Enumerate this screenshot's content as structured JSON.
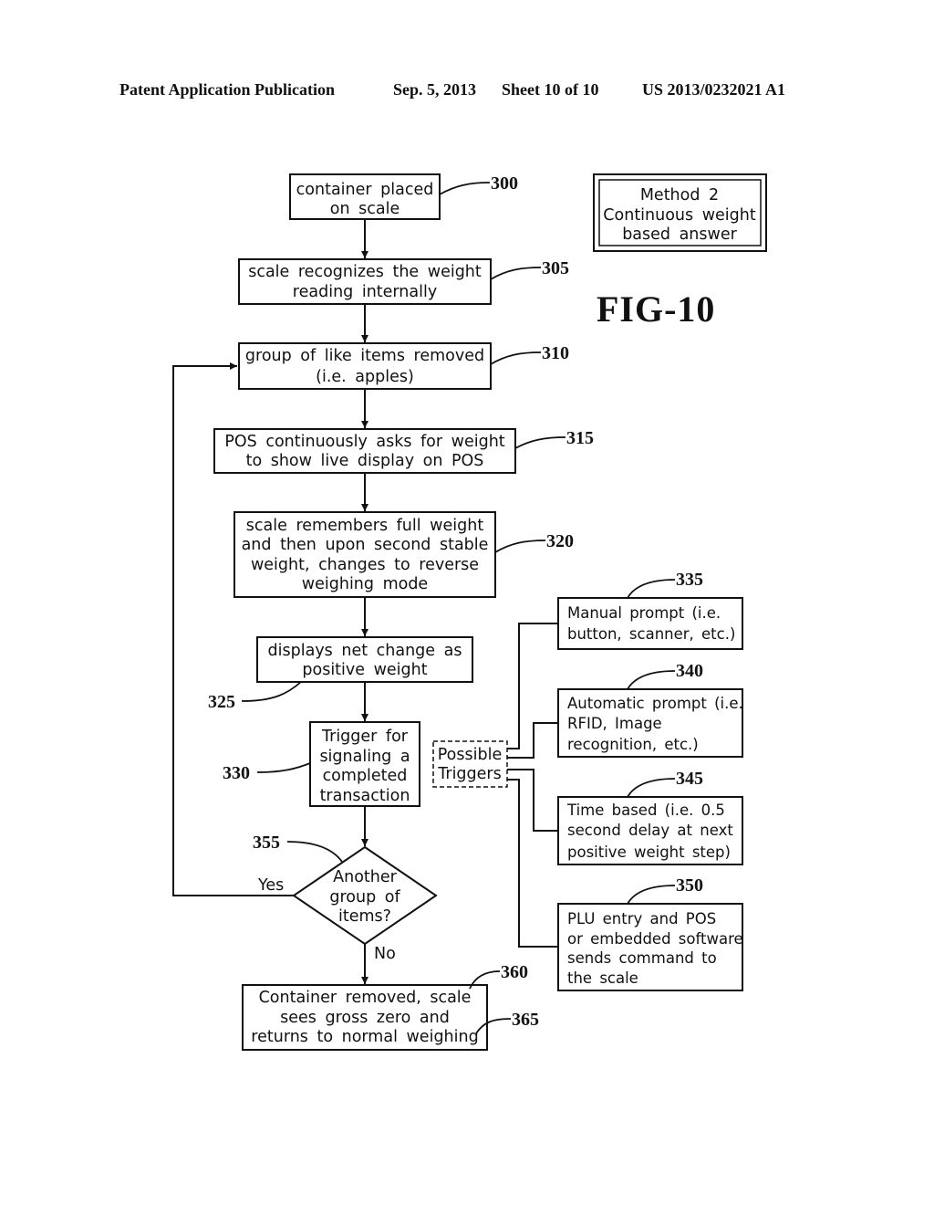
{
  "header": {
    "publication": "Patent Application Publication",
    "date": "Sep. 5, 2013",
    "sheet": "Sheet 10 of 10",
    "number": "US 2013/0232021 A1"
  },
  "figure": {
    "label": "FIG-10",
    "method_box": [
      "Method 2",
      "Continuous weight",
      "based answer"
    ]
  },
  "steps": {
    "s300": {
      "ref": "300",
      "lines": [
        "container placed",
        "on scale"
      ]
    },
    "s305": {
      "ref": "305",
      "lines": [
        "scale recognizes the weight",
        "reading internally"
      ]
    },
    "s310": {
      "ref": "310",
      "lines": [
        "group of like items removed",
        "(i.e. apples)"
      ]
    },
    "s315": {
      "ref": "315",
      "lines": [
        "POS continuously asks for weight",
        "to show live display on POS"
      ]
    },
    "s320": {
      "ref": "320",
      "lines": [
        "scale remembers full weight",
        "and then upon second stable",
        "weight, changes to reverse",
        "weighing mode"
      ]
    },
    "s325": {
      "ref": "325",
      "lines": [
        "displays net change as",
        "positive weight"
      ]
    },
    "s330": {
      "ref": "330",
      "lines": [
        "Trigger for",
        "signaling a",
        "completed",
        "transaction"
      ]
    },
    "s355": {
      "ref": "355",
      "lines": [
        "Another",
        "group of",
        "items?"
      ],
      "yes": "Yes",
      "no": "No"
    },
    "s360": {
      "ref": "360",
      "ref2": "365",
      "lines": [
        "Container removed, scale",
        "sees gross zero and",
        "returns to normal weighing"
      ]
    }
  },
  "triggers": {
    "label": [
      "Possible",
      "Triggers"
    ],
    "t335": {
      "ref": "335",
      "lines": [
        "Manual prompt (i.e.",
        "button, scanner, etc.)"
      ]
    },
    "t340": {
      "ref": "340",
      "lines": [
        "Automatic prompt (i.e.",
        "RFID, Image",
        "recognition, etc.)"
      ]
    },
    "t345": {
      "ref": "345",
      "lines": [
        "Time based (i.e. 0.5",
        "second delay at next",
        "positive weight step)"
      ]
    },
    "t350": {
      "ref": "350",
      "lines": [
        "PLU entry and POS",
        "or embedded software",
        "sends command to",
        "the scale"
      ]
    }
  }
}
